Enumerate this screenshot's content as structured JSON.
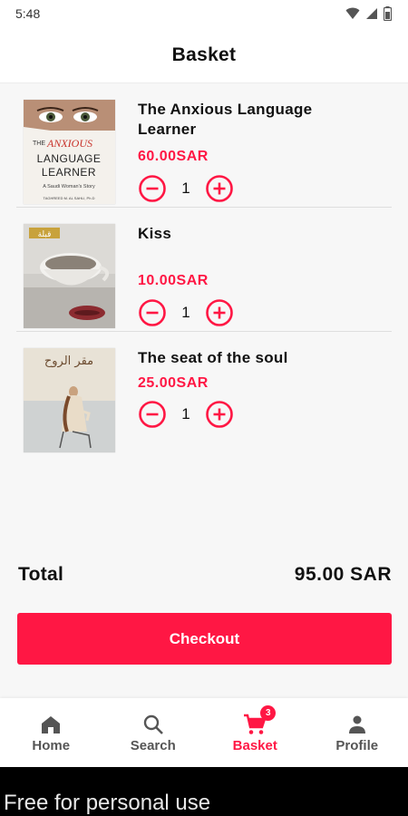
{
  "status_bar": {
    "time": "5:48",
    "icons": [
      "wifi-icon",
      "signal-icon",
      "battery-icon"
    ]
  },
  "header": {
    "title": "Basket"
  },
  "items": [
    {
      "title": "The Anxious Language Learner",
      "price": "60.00SAR",
      "quantity": "1",
      "cover_text": {
        "top": "THE",
        "anxious": "ANXIOUS",
        "line1": "LANGUAGE",
        "line2": "LEARNER",
        "subtitle": "A Saudi Woman's Story",
        "author": "TAGHREED M. AL SAHLI, Ph.D"
      }
    },
    {
      "title": "Kiss",
      "price": "10.00SAR",
      "quantity": "1",
      "cover_text": {
        "top": "قبلة"
      }
    },
    {
      "title": "The seat of the soul",
      "price": "25.00SAR",
      "quantity": "1",
      "cover_text": {
        "top": "مقر الروح"
      }
    }
  ],
  "summary": {
    "total_label": "Total",
    "total_value": "95.00 SAR"
  },
  "checkout": {
    "label": "Checkout"
  },
  "nav": {
    "items": [
      {
        "label": "Home",
        "icon": "home-icon"
      },
      {
        "label": "Search",
        "icon": "search-icon"
      },
      {
        "label": "Basket",
        "icon": "cart-icon",
        "badge": "3",
        "active": true
      },
      {
        "label": "Profile",
        "icon": "person-icon"
      }
    ]
  },
  "watermark": {
    "text": "Free for personal use"
  },
  "colors": {
    "accent": "#ff1744",
    "background": "#f7f7f7",
    "nav_text": "#555555"
  }
}
